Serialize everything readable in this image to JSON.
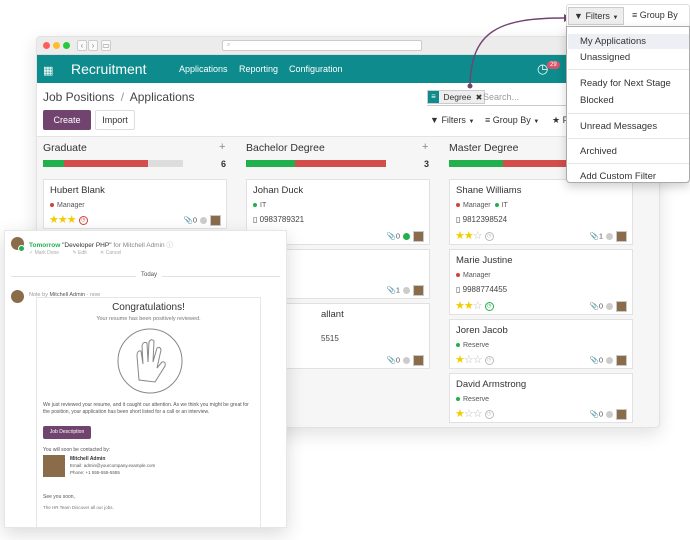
{
  "nav": {
    "brand": "Recruitment",
    "menu": [
      "Applications",
      "Reporting",
      "Configuration"
    ],
    "activity_count": "29"
  },
  "breadcrumb": {
    "parent": "Job Positions",
    "separator": "/",
    "current": "Applications"
  },
  "buttons": {
    "create": "Create",
    "import": "Import"
  },
  "search": {
    "facet": "Degree",
    "placeholder": "Search..."
  },
  "controls": {
    "filters": "Filters",
    "groupby": "Group By",
    "favorites": "F"
  },
  "dropdown": {
    "filters": "Filters",
    "groupby": "Group By",
    "items": [
      "My Applications",
      "Unassigned",
      "Ready for Next Stage",
      "Blocked",
      "Unread Messages",
      "Archived",
      "Add Custom Filter"
    ]
  },
  "colors": {
    "primary": "#71446f",
    "nav": "#0e8b8d",
    "green": "#21b04c",
    "red": "#d34d4b",
    "yellow": "#f3cc00"
  },
  "columns": [
    {
      "title": "Graduate",
      "count": "6",
      "progress": {
        "green": 0.15,
        "red": 0.6,
        "grey": 0.25
      },
      "cards": [
        {
          "name": "Hubert Blank",
          "tags": [
            {
              "label": "Manager",
              "color": "#d0423b"
            }
          ],
          "phone": "",
          "stars": 3,
          "activity": "red",
          "attachments": "0"
        }
      ]
    },
    {
      "title": "Bachelor Degree",
      "count": "3",
      "progress": {
        "green": 0.35,
        "red": 0.65,
        "grey": 0
      },
      "cards": [
        {
          "name": "Johan Duck",
          "tags": [
            {
              "label": "IT",
              "color": "#21b04c"
            }
          ],
          "phone": "0983789321",
          "stars": 0,
          "activity": "red",
          "attachments": "0"
        },
        {
          "name": "",
          "tags": [],
          "phone": "",
          "stars": 0,
          "activity": "green",
          "attachments": "1"
        },
        {
          "name": "allant",
          "tags": [],
          "phone": "5515",
          "stars": 0,
          "activity": "red",
          "attachments": "0"
        }
      ]
    },
    {
      "title": "Master Degree",
      "count": "",
      "progress": {
        "green": 0.3,
        "red": 0.45,
        "yellow": 0.1,
        "grey": 0.15
      },
      "cards": [
        {
          "name": "Shane Williams",
          "tags": [
            {
              "label": "Manager",
              "color": "#d0423b"
            },
            {
              "label": "IT",
              "color": "#21b04c"
            }
          ],
          "phone": "9812398524",
          "stars": 2,
          "activity": "grey",
          "attachments": "1"
        },
        {
          "name": "Marie Justine",
          "tags": [
            {
              "label": "Manager",
              "color": "#d0423b"
            }
          ],
          "phone": "9988774455",
          "stars": 2,
          "activity": "green",
          "attachments": "0"
        },
        {
          "name": "Joren Jacob",
          "tags": [
            {
              "label": "Reserve",
              "color": "#21b04c"
            }
          ],
          "phone": "",
          "stars": 1,
          "activity": "grey",
          "attachments": "0"
        },
        {
          "name": "David Armstrong",
          "tags": [
            {
              "label": "Reserve",
              "color": "#21b04c"
            }
          ],
          "phone": "",
          "stars": 1,
          "activity": "grey",
          "attachments": "0"
        }
      ]
    }
  ],
  "chat": {
    "activity": {
      "when": "Tomorrow",
      "title": "\"Developer PHP\"",
      "for_label": "for",
      "who": "Mitchell Admin",
      "actions": [
        "Mark Done",
        "Edit",
        "Cancel"
      ]
    },
    "today": "Today",
    "note": {
      "label": "Note by",
      "author": "Mitchell Admin",
      "dash": "-",
      "when": "now"
    },
    "email": {
      "title": "Congratulations!",
      "subtitle": "Your resume has been positively reviewed.",
      "body": "We just reviewed your resume, and it caught our attention. As we think you might be great for the position, your application has been short listed for a call or an interview.",
      "button": "Job Description",
      "contact_intro": "You will soon be contacted by:",
      "contact_name": "Mitchell Admin",
      "contact_email": "Email: admin@yourcompany.example.com",
      "contact_phone": "Phone: +1 555-555-5555",
      "signoff": "See you soon,",
      "team": "The HR Team Discover all our jobs."
    }
  }
}
